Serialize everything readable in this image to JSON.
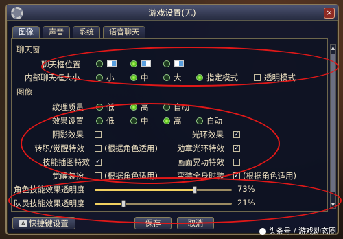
{
  "window": {
    "title": "游戏设置(无)",
    "close_label": "×"
  },
  "tabs": [
    "图像",
    "声音",
    "系统",
    "语音聊天"
  ],
  "chat_window": {
    "section_label": "聊天窗",
    "position_label": "聊天框位置",
    "size_label": "内部聊天框大小",
    "size_options": [
      "小",
      "中",
      "大"
    ],
    "size_selected": "中",
    "mode_label": "指定模式",
    "transparent_label": "透明模式"
  },
  "image": {
    "section_label": "图像",
    "texture_label": "纹理质量",
    "texture_options": [
      "低",
      "高",
      "自动"
    ],
    "texture_selected": "高",
    "effects_label": "效果设置",
    "effects_options": [
      "低",
      "中",
      "高",
      "自动"
    ],
    "effects_selected": "高"
  },
  "toggles": {
    "shadow_label": "阴影效果",
    "shadow_checked": false,
    "halo_label": "光环效果",
    "halo_checked": true,
    "awaken_label": "转职/觉醒特效",
    "awaken_note": "(根据角色适用)",
    "awaken_checked": false,
    "medal_label": "勋章光环特效",
    "medal_checked": true,
    "skill_insert_label": "技能插图特效",
    "skill_insert_checked": true,
    "screen_shake_label": "画面晃动特效",
    "screen_shake_checked": false,
    "awaken_costume_label": "觉醒装扮",
    "awaken_costume_note": "(根据角色适用)",
    "awaken_costume_checked": false,
    "costume_label": "变装全身时装",
    "costume_note": "(根据角色适用)",
    "costume_checked": true
  },
  "sliders": {
    "char_skill_label": "角色技能效果透明度",
    "char_skill_value": "73%",
    "char_skill_level": 0.73,
    "member_skill_label": "队员技能效果透明度",
    "member_skill_value": "21%",
    "member_skill_level": 0.21
  },
  "footer": {
    "hotkey_label": "快捷键设置",
    "save_label": "保存",
    "cancel_label": "取消"
  },
  "watermark": {
    "text": "头条号 / 游戏动态圈"
  },
  "colors": {
    "accent_green": "#55c21c",
    "highlight_red": "#e01818",
    "gold": "#f0d060"
  }
}
